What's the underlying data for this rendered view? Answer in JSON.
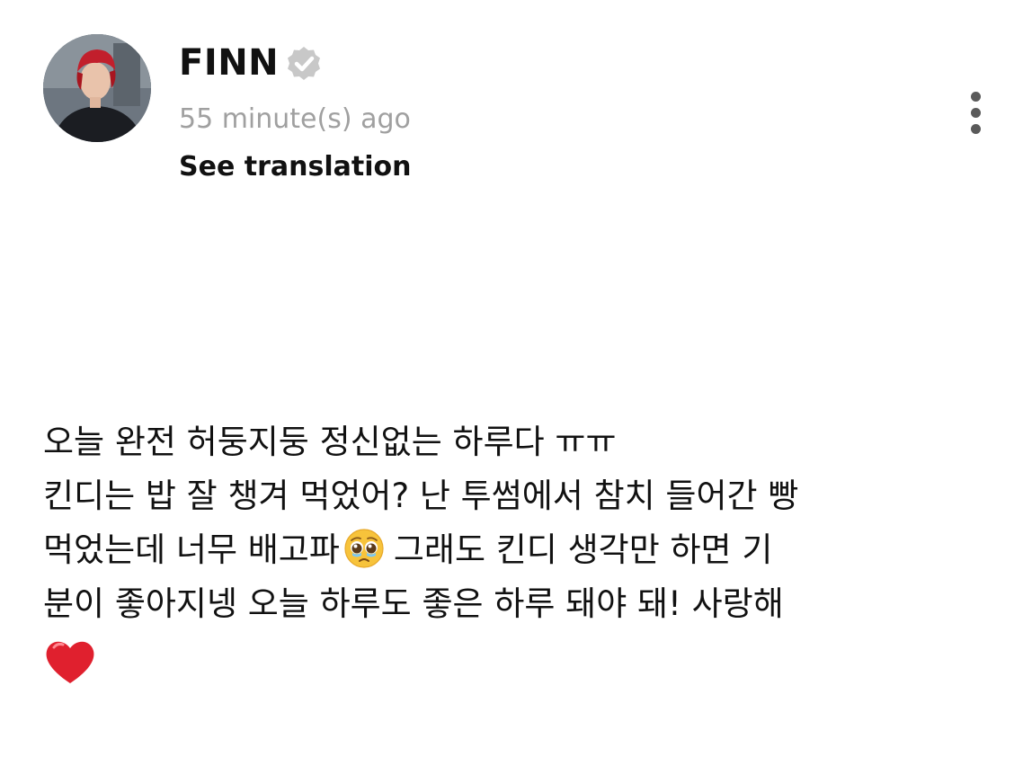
{
  "post": {
    "author": {
      "name": "FINN",
      "verified_icon": "verified-badge-icon",
      "avatar_icon": "avatar-portrait"
    },
    "timestamp": "55 minute(s) ago",
    "translate_label": "See translation",
    "more_icon": "more-vertical-icon",
    "body": {
      "line1": "오늘 완전 허둥지둥 정신없는 하루다 ㅠㅠ",
      "line2": "킨디는 밥 잘 챙겨 먹었어? 난 투썸에서 참치 들어간 빵",
      "line3_before_emoji": "먹었는데 너무 배고파",
      "line3_after_emoji": "그래도 킨디 생각만 하면 기",
      "line4": "분이 좋아지넹 오늘 하루도 좋은 하루 돼야 돼! 사랑해",
      "emojis": [
        "pleading-face-emoji",
        "red-heart-emoji"
      ]
    }
  },
  "colors": {
    "text": "#111111",
    "muted": "#a0a0a0",
    "badge": "#c8c8c8",
    "more_dots": "#5a5a5a",
    "heart": "#e0202e"
  }
}
